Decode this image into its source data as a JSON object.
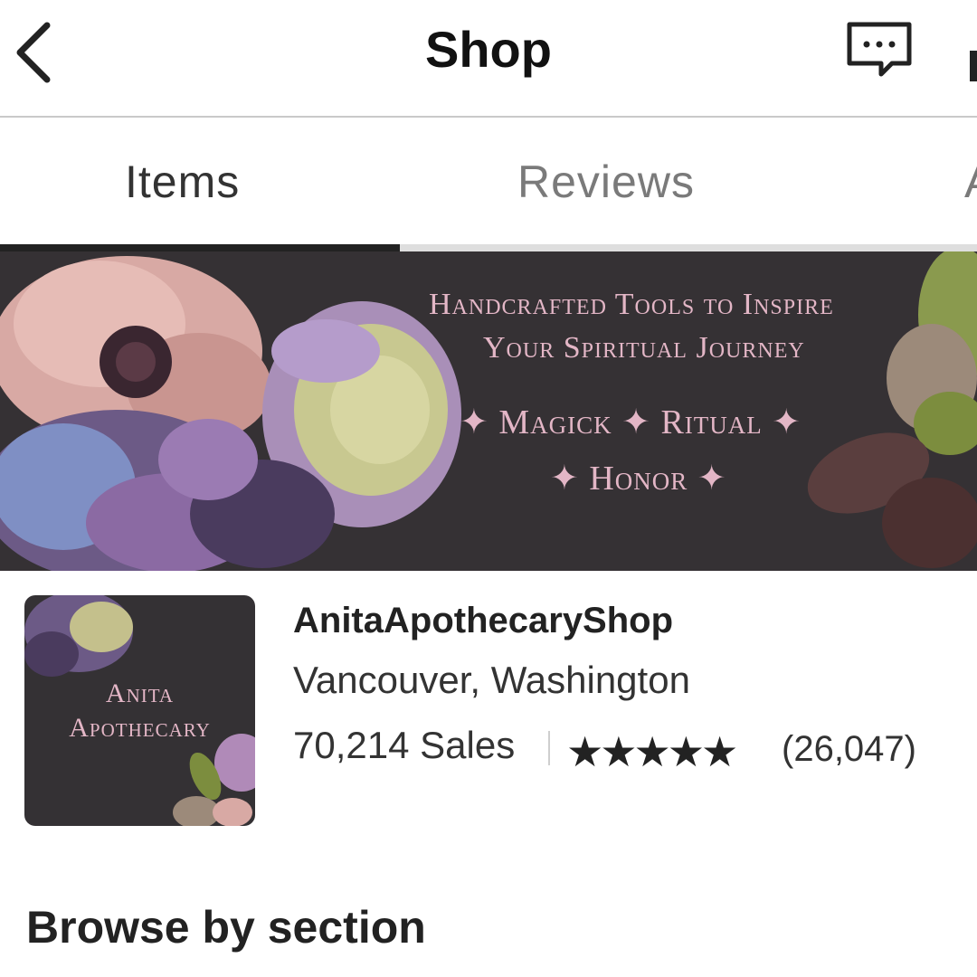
{
  "header": {
    "title": "Shop",
    "back_icon": "chevron-left-icon",
    "message_icon": "message-bubble-icon"
  },
  "tabs": [
    {
      "label": "Items",
      "active": true
    },
    {
      "label": "Reviews",
      "active": false
    },
    {
      "label": "A",
      "active": false
    }
  ],
  "banner": {
    "line1": "Handcrafted Tools to Inspire",
    "line2": "Your Spiritual Journey",
    "line3": "✦ Magick ✦ Ritual ✦",
    "line4": "✦ Honor ✦"
  },
  "shop": {
    "logo_line1": "Anita",
    "logo_line2": "Apothecary",
    "name": "AnitaApothecaryShop",
    "location": "Vancouver, Washington",
    "sales": "70,214 Sales",
    "stars": "★★★★★",
    "rating": 5,
    "review_count": "(26,047)"
  },
  "section": {
    "title": "Browse by section"
  },
  "colors": {
    "banner_bg": "#353134",
    "banner_text": "#e3b6c6",
    "active_tab": "#222222"
  }
}
